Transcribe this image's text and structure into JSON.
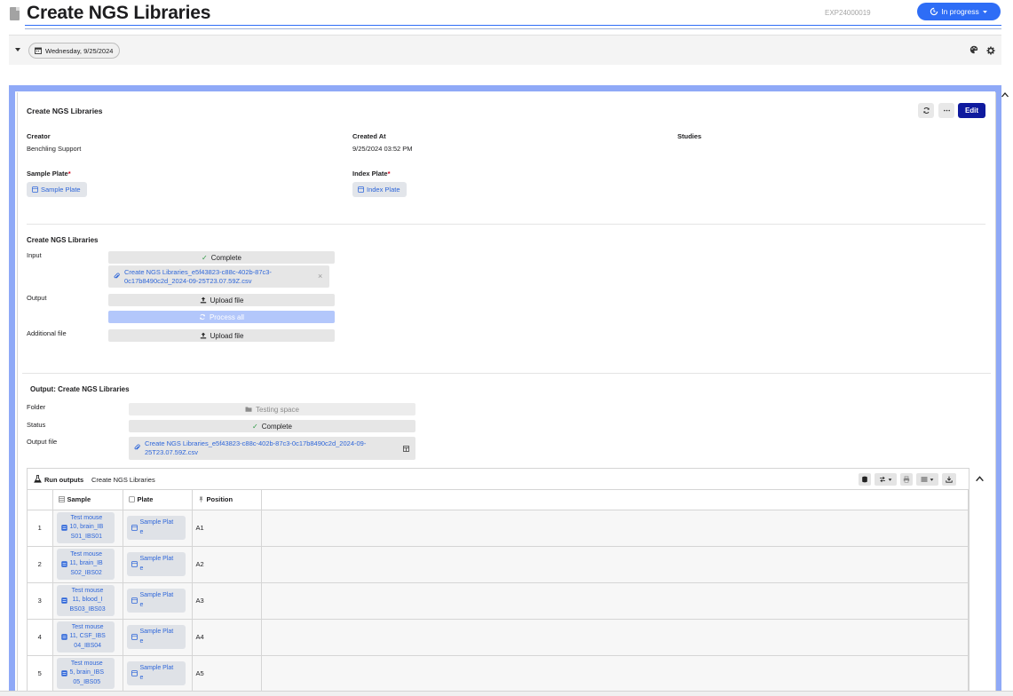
{
  "header": {
    "title": "Create NGS Libraries",
    "experiment_id": "EXP24000019",
    "status": "In progress"
  },
  "datebar": {
    "date": "Wednesday, 9/25/2024"
  },
  "form": {
    "title": "Create NGS Libraries",
    "edit_label": "Edit",
    "fields": {
      "creator_label": "Creator",
      "creator_value": "Benchling Support",
      "created_at_label": "Created At",
      "created_at_value": "9/25/2024 03:52 PM",
      "studies_label": "Studies",
      "sample_plate_label": "Sample Plate",
      "sample_plate_value": "Sample Plate",
      "index_plate_label": "Index Plate",
      "index_plate_value": "Index Plate",
      "required_mark": "*"
    }
  },
  "run": {
    "title": "Create NGS Libraries",
    "input_label": "Input",
    "input_status": "Complete",
    "input_file_line1": "Create NGS Libraries_e5f43823-c88c-402b-87c3-",
    "input_file_line2": "0c17b8490c2d_2024-09-25T23.07.59Z.csv",
    "output_label": "Output",
    "upload_label": "Upload file",
    "process_label": "Process all",
    "additional_label": "Additional file",
    "additional_upload_label": "Upload file"
  },
  "output": {
    "title": "Output: Create NGS Libraries",
    "folder_label": "Folder",
    "folder_value": "Testing space",
    "status_label": "Status",
    "status_value": "Complete",
    "file_label": "Output file",
    "file_line1": "Create NGS Libraries_e5f43823-c88c-402b-87c3-0c17b8490c2d_2024-09-",
    "file_line2": "25T23.07.59Z.csv"
  },
  "grid": {
    "title": "Run outputs",
    "subtitle": "Create NGS Libraries",
    "columns": [
      "Sample",
      "Plate",
      "Position"
    ],
    "rows": [
      {
        "num": "1",
        "sample": [
          "Test mouse",
          "10, brain_IB",
          "S01_IBS01"
        ],
        "plate": [
          "Sample Plat",
          "e"
        ],
        "position": "A1"
      },
      {
        "num": "2",
        "sample": [
          "Test mouse",
          "11, brain_IB",
          "S02_IBS02"
        ],
        "plate": [
          "Sample Plat",
          "e"
        ],
        "position": "A2"
      },
      {
        "num": "3",
        "sample": [
          "Test mouse",
          "11, blood_I",
          "BS03_IBS03"
        ],
        "plate": [
          "Sample Plat",
          "e"
        ],
        "position": "A3"
      },
      {
        "num": "4",
        "sample": [
          "Test mouse",
          "11, CSF_IBS",
          "04_IBS04"
        ],
        "plate": [
          "Sample Plat",
          "e"
        ],
        "position": "A4"
      },
      {
        "num": "5",
        "sample": [
          "Test mouse",
          "5, brain_IBS",
          "05_IBS05"
        ],
        "plate": [
          "Sample Plat",
          "e"
        ],
        "position": "A5"
      }
    ]
  }
}
